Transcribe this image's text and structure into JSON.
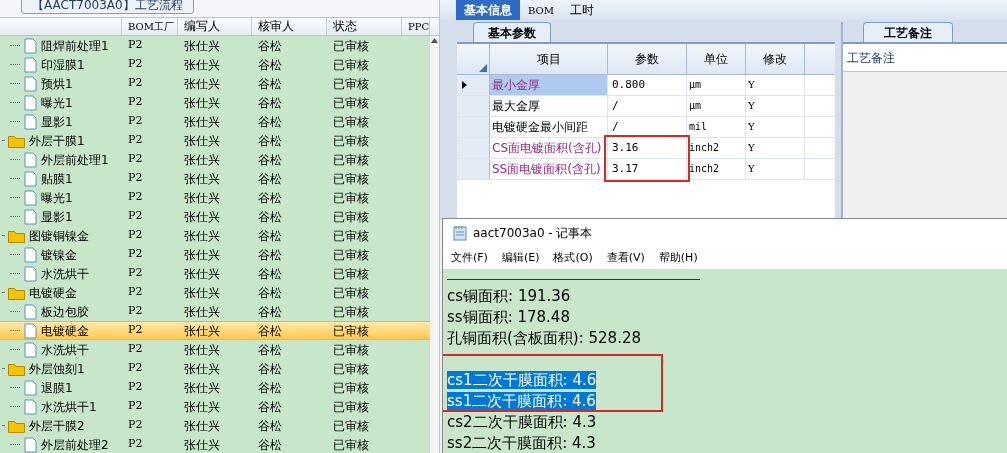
{
  "left_panel": {
    "group_title": "【AACT7003A0】工艺流程",
    "columns": [
      "BOM工厂",
      "编写人",
      "核审人",
      "状态",
      "PPC"
    ],
    "tree": [
      {
        "children": [
          {
            "label": "阻焊前处理1",
            "cells": [
              "P2",
              "张仕兴",
              "谷松",
              "已审核"
            ],
            "selected": false
          },
          {
            "label": "印湿膜1",
            "cells": [
              "P2",
              "张仕兴",
              "谷松",
              "已审核"
            ],
            "selected": false
          },
          {
            "label": "预烘1",
            "cells": [
              "P2",
              "张仕兴",
              "谷松",
              "已审核"
            ],
            "selected": false
          },
          {
            "label": "曝光1",
            "cells": [
              "P2",
              "张仕兴",
              "谷松",
              "已审核"
            ],
            "selected": false
          },
          {
            "label": "显影1",
            "cells": [
              "P2",
              "张仕兴",
              "谷松",
              "已审核"
            ],
            "selected": false
          }
        ]
      },
      {
        "label": "外层干膜1",
        "cells": [
          "P2",
          "张仕兴",
          "谷松",
          "已审核"
        ],
        "selected": false,
        "children": [
          {
            "label": "外层前处理1",
            "cells": [
              "P2",
              "张仕兴",
              "谷松",
              "已审核"
            ],
            "selected": false
          },
          {
            "label": "贴膜1",
            "cells": [
              "P2",
              "张仕兴",
              "谷松",
              "已审核"
            ],
            "selected": false
          },
          {
            "label": "曝光1",
            "cells": [
              "P2",
              "张仕兴",
              "谷松",
              "已审核"
            ],
            "selected": false
          },
          {
            "label": "显影1",
            "cells": [
              "P2",
              "张仕兴",
              "谷松",
              "已审核"
            ],
            "selected": false
          }
        ]
      },
      {
        "label": "图镀铜镍金",
        "cells": [
          "P2",
          "张仕兴",
          "谷松",
          "已审核"
        ],
        "selected": false,
        "children": [
          {
            "label": "镀镍金",
            "cells": [
              "P2",
              "张仕兴",
              "谷松",
              "已审核"
            ],
            "selected": false
          },
          {
            "label": "水洗烘干",
            "cells": [
              "P2",
              "张仕兴",
              "谷松",
              "已审核"
            ],
            "selected": false
          }
        ]
      },
      {
        "label": "电镀硬金",
        "cells": [
          "P2",
          "张仕兴",
          "谷松",
          "已审核"
        ],
        "selected": false,
        "children": [
          {
            "label": "板边包胶",
            "cells": [
              "P2",
              "张仕兴",
              "谷松",
              "已审核"
            ],
            "selected": false
          },
          {
            "label": "电镀硬金",
            "cells": [
              "P2",
              "张仕兴",
              "谷松",
              "已审核"
            ],
            "selected": true
          },
          {
            "label": "水洗烘干",
            "cells": [
              "P2",
              "张仕兴",
              "谷松",
              "已审核"
            ],
            "selected": false
          }
        ]
      },
      {
        "label": "外层蚀刻1",
        "cells": [
          "P2",
          "张仕兴",
          "谷松",
          "已审核"
        ],
        "selected": false,
        "children": [
          {
            "label": "退膜1",
            "cells": [
              "P2",
              "张仕兴",
              "谷松",
              "已审核"
            ],
            "selected": false
          },
          {
            "label": "水洗烘干1",
            "cells": [
              "P2",
              "张仕兴",
              "谷松",
              "已审核"
            ],
            "selected": false
          }
        ]
      },
      {
        "label": "外层干膜2",
        "cells": [
          "P2",
          "张仕兴",
          "谷松",
          "已审核"
        ],
        "selected": false,
        "children": [
          {
            "label": "外层前处理2",
            "cells": [
              "P2",
              "张仕兴",
              "谷松",
              "已审核"
            ],
            "selected": false
          }
        ]
      }
    ]
  },
  "top_tabs": [
    {
      "label": "基本信息",
      "selected": true
    },
    {
      "label": "BOM",
      "selected": false
    },
    {
      "label": "工时",
      "selected": false
    }
  ],
  "params": {
    "tab": "基本参数",
    "columns": [
      "项目",
      "参数",
      "单位",
      "修改"
    ],
    "rows": [
      {
        "item": "最小金厚",
        "value": "0.800",
        "unit": "μm",
        "modify": "Y",
        "current": true,
        "emphasized": true,
        "circled": false
      },
      {
        "item": "最大金厚",
        "value": "/",
        "unit": "μm",
        "modify": "Y",
        "current": false,
        "emphasized": false,
        "circled": false
      },
      {
        "item": "电镀硬金最小间距",
        "value": "/",
        "unit": "mil",
        "modify": "Y",
        "current": false,
        "emphasized": false,
        "circled": false
      },
      {
        "item": "CS面电镀面积(含孔)",
        "value": "3.16",
        "unit": "inch2",
        "modify": "Y",
        "current": false,
        "emphasized": true,
        "circled": true
      },
      {
        "item": "SS面电镀面积(含孔)",
        "value": "3.17",
        "unit": "inch2",
        "modify": "Y",
        "current": false,
        "emphasized": true,
        "circled": true
      }
    ]
  },
  "notes": {
    "tab": "工艺备注",
    "label": "工艺备注"
  },
  "notepad": {
    "title": "aact7003a0 - 记事本",
    "menu": [
      "文件(F)",
      "编辑(E)",
      "格式(O)",
      "查看(V)",
      "帮助(H)"
    ],
    "lines": [
      {
        "text": "cs铜面积: 191.36",
        "selected": false,
        "circled": false
      },
      {
        "text": "ss铜面积: 178.48",
        "selected": false,
        "circled": false
      },
      {
        "text": "孔铜面积(含板面积): 528.28",
        "selected": false,
        "circled": false
      },
      {
        "circled": true
      },
      {
        "text": "cs1二次干膜面积: 4.6",
        "selected": true,
        "circled": true
      },
      {
        "text": "ss1二次干膜面积: 4.6",
        "selected": true,
        "circled": true
      },
      {
        "text": "cs2二次干膜面积: 4.3",
        "selected": false,
        "circled": false
      },
      {
        "text": "ss2二次干膜面积: 4.3",
        "selected": false,
        "circled": false
      }
    ]
  }
}
